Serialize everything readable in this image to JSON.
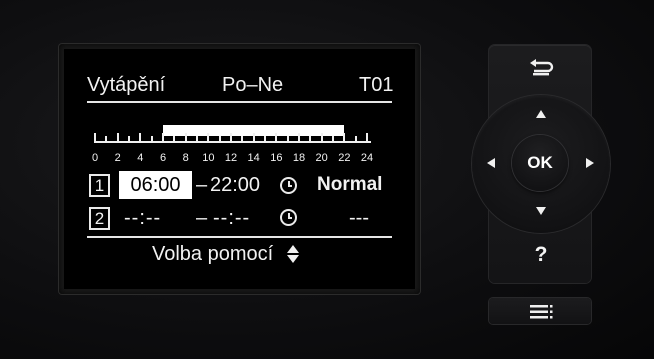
{
  "display": {
    "header": {
      "mode": "Vytápění",
      "days": "Po–Ne",
      "program": "T01"
    },
    "timeline": {
      "tick_labels": [
        "0",
        "2",
        "4",
        "6",
        "8",
        "10",
        "12",
        "14",
        "16",
        "18",
        "20",
        "22",
        "24"
      ],
      "active_from_hour": 6,
      "active_to_hour": 22
    },
    "rows": [
      {
        "number": "1",
        "start": "06:00",
        "dash": "–",
        "end": "22:00",
        "mode": "Normal"
      },
      {
        "number": "2",
        "start": "--:--",
        "dash": "–",
        "end": "--:--",
        "mode": "---"
      }
    ],
    "footer": {
      "hint": "Volba pomocí"
    }
  },
  "controls": {
    "back": "back-arrow-icon",
    "up": "arrow-up-icon",
    "down": "arrow-down-icon",
    "left": "arrow-left-icon",
    "right": "arrow-right-icon",
    "ok_label": "OK",
    "help_label": "?",
    "menu": "menu-icon"
  }
}
